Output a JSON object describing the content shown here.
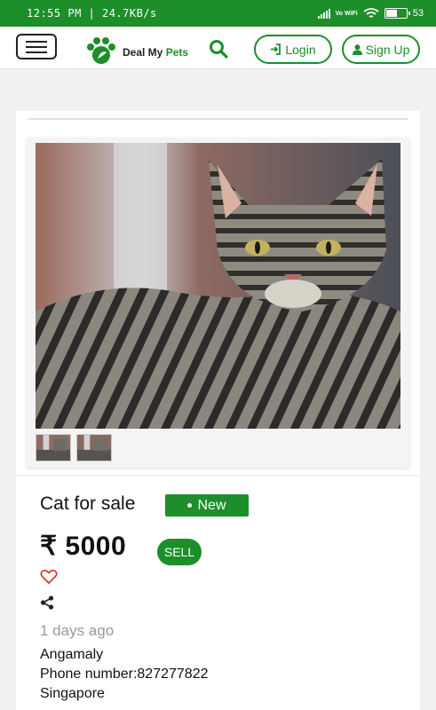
{
  "status_bar": {
    "time": "12:55 PM | 24.7KB/s",
    "network": "Vo WiFi",
    "battery": "53"
  },
  "header": {
    "brand_prefix": "Deal My",
    "brand_suffix": "Pets",
    "login_label": "Login",
    "signup_label": "Sign Up",
    "accent_color": "#1c8e2a"
  },
  "listing": {
    "title": "Cat for sale",
    "condition_badge": "New",
    "price": "₹ 5000",
    "type_badge": "SELL",
    "posted": "1 days ago",
    "location": "Angamaly",
    "phone": "Phone number:827277822",
    "country": "Singapore",
    "icons": [
      "heart-icon",
      "share-icon"
    ]
  }
}
